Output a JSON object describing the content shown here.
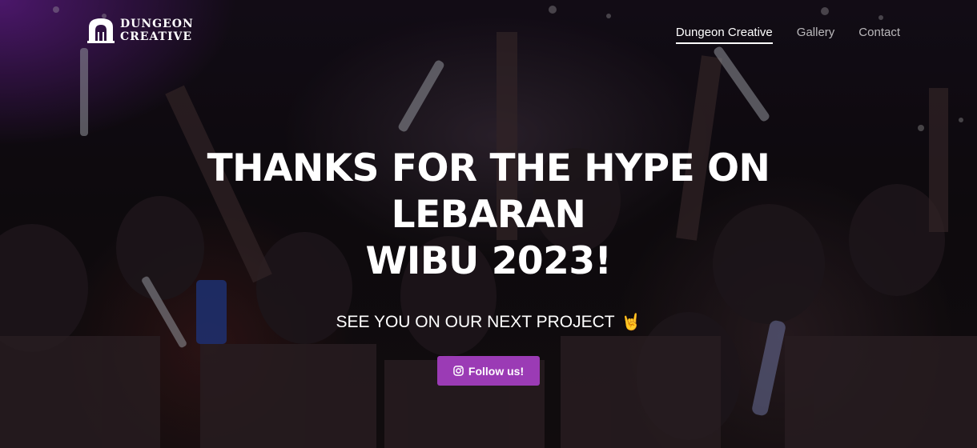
{
  "brand": {
    "line1": "DUNGEON",
    "line2": "CREATIVE",
    "logo_icon": "dungeon-gate-icon"
  },
  "nav": {
    "items": [
      {
        "label": "Dungeon Creative",
        "active": true
      },
      {
        "label": "Gallery",
        "active": false
      },
      {
        "label": "Contact",
        "active": false
      }
    ]
  },
  "hero": {
    "title_line1": "THANKS FOR THE HYPE ON LEBARAN",
    "title_line2": "WIBU 2023!",
    "subtitle": "SEE YOU ON OUR NEXT PROJECT",
    "subtitle_emoji": "🤘",
    "button_label": "Follow us!",
    "button_icon": "instagram-icon"
  },
  "colors": {
    "accent": "#9b3bb5",
    "text": "#ffffff"
  }
}
